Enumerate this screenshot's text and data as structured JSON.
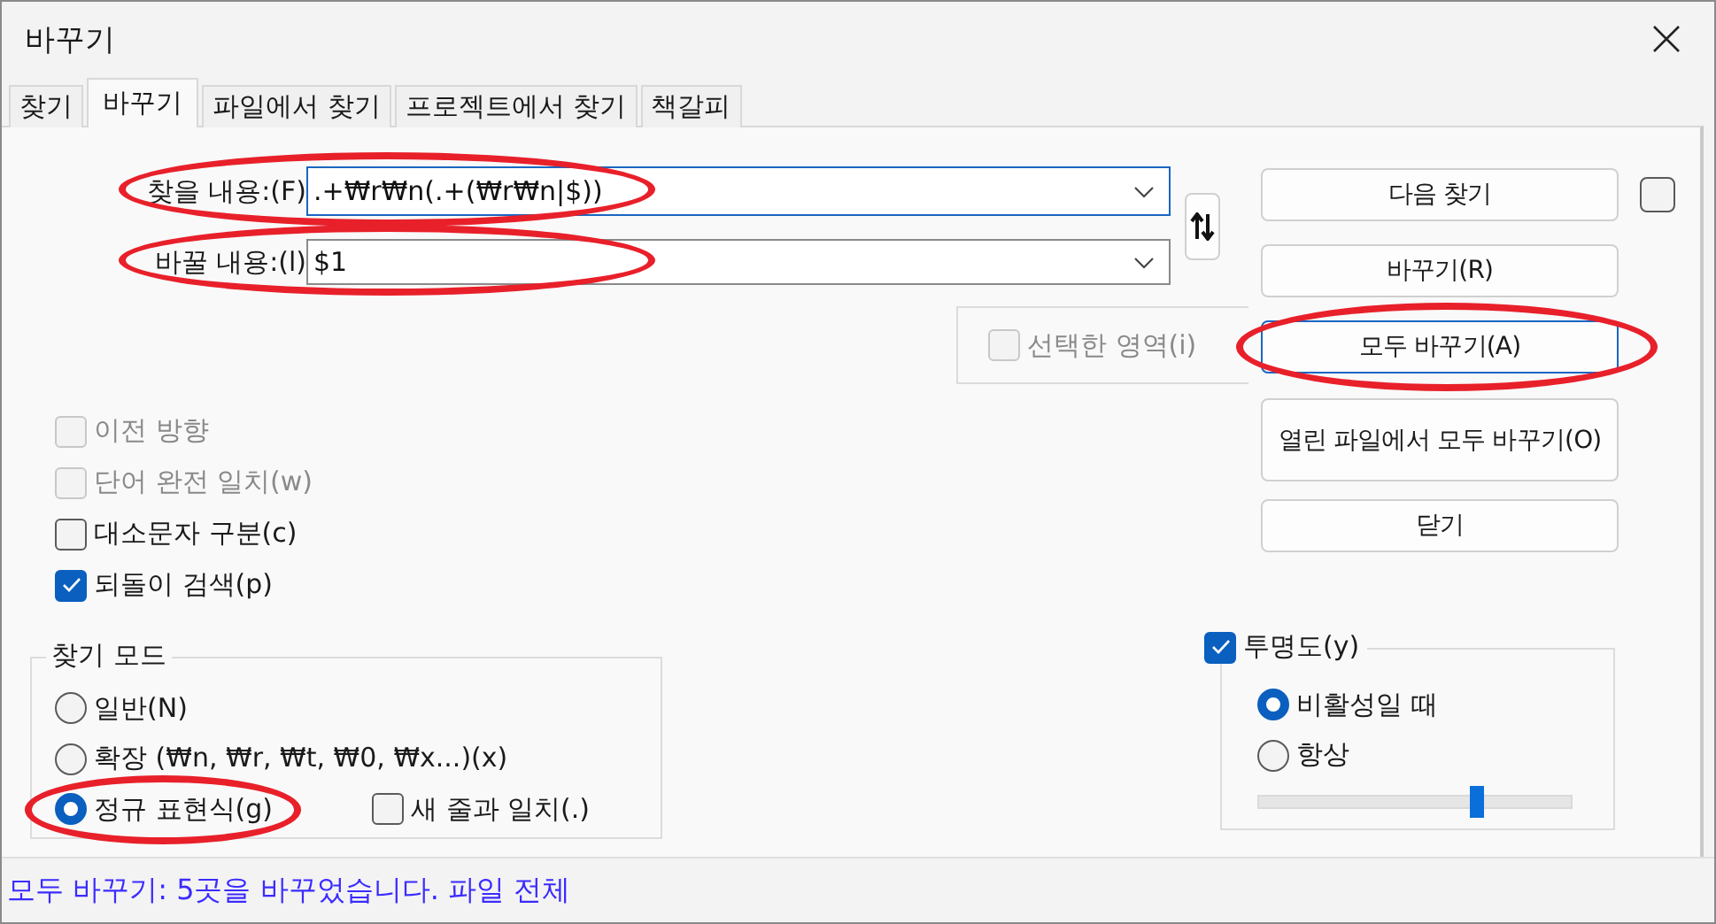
{
  "window": {
    "title": "바꾸기"
  },
  "tabs": [
    {
      "label": "찾기",
      "selected": false
    },
    {
      "label": "바꾸기",
      "selected": true
    },
    {
      "label": "파일에서 찾기",
      "selected": false
    },
    {
      "label": "프로젝트에서 찾기",
      "selected": false
    },
    {
      "label": "책갈피",
      "selected": false
    }
  ],
  "fields": [
    {
      "label": "찾을 내용:(F)",
      "value": ".+₩r₩n(.+(₩r₩n|$))",
      "focused": true,
      "circled": true
    },
    {
      "label": "바꿀 내용:(l)",
      "value": "$1",
      "focused": false,
      "circled": true
    }
  ],
  "in_selection": {
    "label": "선택한 영역(i)",
    "checked": false,
    "disabled": true
  },
  "buttons": [
    {
      "label": "다음 찾기",
      "focused": false,
      "circled": false
    },
    {
      "label": "바꾸기(R)",
      "focused": false,
      "circled": false
    },
    {
      "label": "모두 바꾸기(A)",
      "focused": true,
      "circled": true
    },
    {
      "label": "열린 파일에서 모두 바꾸기(O)",
      "focused": false,
      "circled": false
    },
    {
      "label": "닫기",
      "focused": false,
      "circled": false
    }
  ],
  "side_checkbox": {
    "checked": false
  },
  "options": [
    {
      "label": "이전 방향",
      "checked": false,
      "disabled": true
    },
    {
      "label": "단어 완전 일치(w)",
      "checked": false,
      "disabled": true
    },
    {
      "label": "대소문자 구분(c)",
      "checked": false,
      "disabled": false
    },
    {
      "label": "되돌이 검색(p)",
      "checked": true,
      "disabled": false
    }
  ],
  "search_mode": {
    "title": "찾기 모드",
    "options": [
      {
        "label": "일반(N)",
        "selected": false,
        "circled": false
      },
      {
        "label": "확장 (₩n, ₩r, ₩t, ₩0, ₩x...)(x)",
        "selected": false,
        "circled": false
      },
      {
        "label": "정규 표현식(g)",
        "selected": true,
        "circled": true
      }
    ],
    "newline": {
      "label": "새 줄과 일치(.)",
      "checked": false
    }
  },
  "transparency": {
    "label": "투명도(y)",
    "checked": true,
    "options": [
      {
        "label": "비활성일 때",
        "selected": true
      },
      {
        "label": "항상",
        "selected": false
      }
    ],
    "level": 0.7
  },
  "status": "모두 바꾸기: 5곳을 바꾸었습니다. 파일 전체"
}
